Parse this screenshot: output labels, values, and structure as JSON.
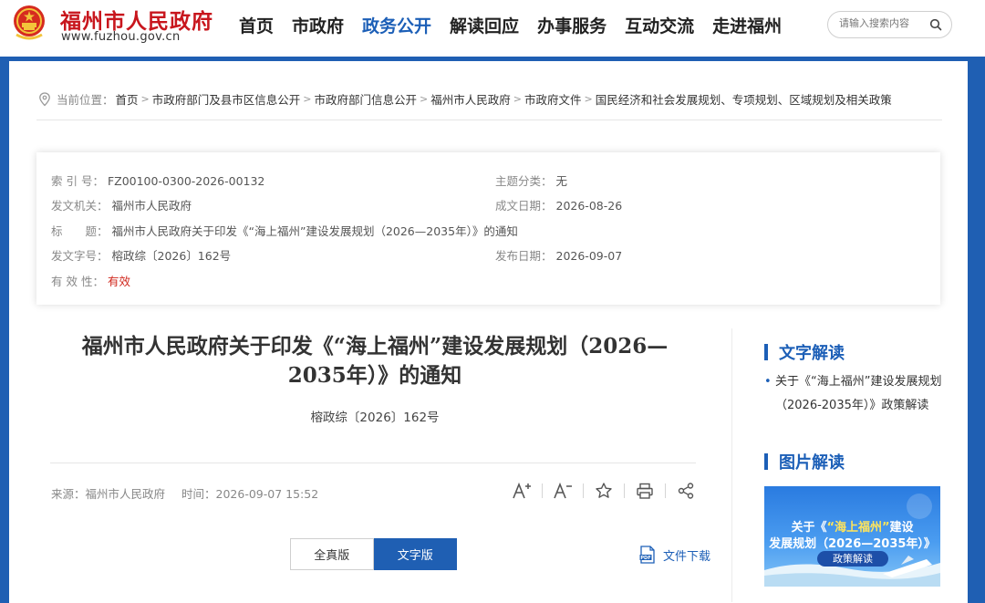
{
  "header": {
    "site_title": "福州市人民政府",
    "site_domain": "www.fuzhou.gov.cn",
    "nav": [
      {
        "label": "首页",
        "active": false
      },
      {
        "label": "市政府",
        "active": false
      },
      {
        "label": "政务公开",
        "active": true
      },
      {
        "label": "解读回应",
        "active": false
      },
      {
        "label": "办事服务",
        "active": false
      },
      {
        "label": "互动交流",
        "active": false
      },
      {
        "label": "走进福州",
        "active": false
      }
    ],
    "search_placeholder": "请输入搜索内容"
  },
  "breadcrumb": {
    "label": "当前位置：",
    "items": [
      "首页",
      "市政府部门及县市区信息公开",
      "市政府部门信息公开",
      "福州市人民政府",
      "市政府文件",
      "国民经济和社会发展规划、专项规划、区域规划及相关政策"
    ],
    "separator": ">"
  },
  "meta": {
    "index_label": "索 引 号：",
    "index_value": "FZ00100-0300-2026-00132",
    "category_label": "主题分类：",
    "category_value": "无",
    "issuer_label": "发文机关：",
    "issuer_value": "福州市人民政府",
    "written_date_label": "成文日期：",
    "written_date_value": "2026-08-26",
    "title_label": "标　　题：",
    "title_value": "福州市人民政府关于印发《“海上福州”建设发展规划（2026—2035年）》的通知",
    "doc_no_label": "发文字号：",
    "doc_no_value": "榕政综〔2026〕162号",
    "publish_date_label": "发布日期：",
    "publish_date_value": "2026-09-07",
    "validity_label": "有 效 性：",
    "validity_value": "有效"
  },
  "document": {
    "title_line1": "福州市人民政府关于印发《“海上福州”建设发展规划（2026—",
    "title_line2": "2035年）》的通知",
    "number": "榕政综〔2026〕162号",
    "source_label": "来源：",
    "source_value": "福州市人民政府",
    "time_label": "时间：",
    "time_value": "2026-09-07 15:52",
    "toggle_full": "全真版",
    "toggle_text": "文字版",
    "download_label": "文件下载"
  },
  "sidebar": {
    "text_heading": "文字解读",
    "text_link": "关于《“海上福州”建设发展规划（2026-2035年）》政策解读",
    "image_heading": "图片解读",
    "promo_prefix": "关于《",
    "promo_highlight": "“海上福州”",
    "promo_suffix": "建设",
    "promo_line2": "发展规划（2026—2035年）》",
    "promo_badge": "政策解读"
  },
  "colors": {
    "brand_blue": "#1f5fb3",
    "brand_red": "#c8161d",
    "validity_red": "#d0281e",
    "highlight_yellow": "#ffe45c"
  },
  "icons": [
    "national-emblem-icon",
    "search-icon",
    "location-icon",
    "font-increase-icon",
    "font-decrease-icon",
    "star-icon",
    "print-icon",
    "share-icon",
    "pdf-icon"
  ]
}
